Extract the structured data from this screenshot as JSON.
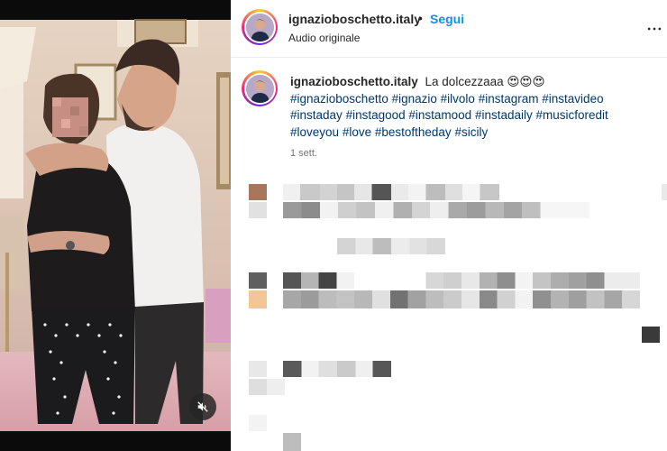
{
  "post": {
    "username": "ignazioboschetto.italy",
    "dot": "•",
    "follow_label": "Segui",
    "audio_label": "Audio originale",
    "caption_text": "La dolcezzaaa 😍😍😍",
    "hashtags": [
      "#ignazioboschetto",
      "#ignazio",
      "#ilvolo",
      "#instagram",
      "#instavideo",
      "#instaday",
      "#instagood",
      "#instamood",
      "#instadaily",
      "#musicforedit",
      "#loveyou",
      "#love",
      "#bestoftheday",
      "#sicily"
    ],
    "time": "1 sett."
  },
  "icons": {
    "more": "more-horizontal-icon",
    "mute": "muted-speaker-icon"
  },
  "colors": {
    "link_blue": "#0095f6",
    "hashtag": "#00376b",
    "muted_text": "#737373"
  }
}
